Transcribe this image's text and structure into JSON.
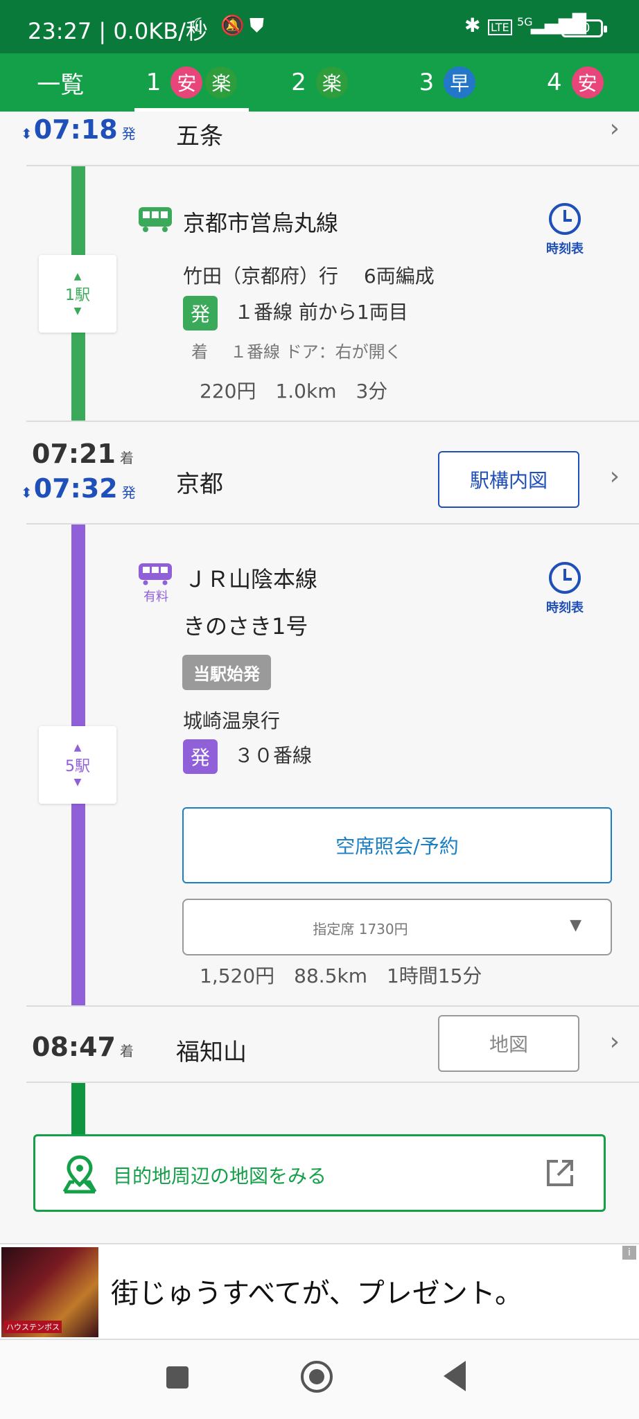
{
  "status_bar": {
    "time": "23:27",
    "speed": "0.0KB/秒",
    "battery": "80",
    "network": "5G"
  },
  "tabs": [
    {
      "num": "一覧",
      "badges": []
    },
    {
      "num": "1",
      "badges": [
        "安",
        "楽"
      ]
    },
    {
      "num": "2",
      "badges": [
        "楽"
      ]
    },
    {
      "num": "3",
      "badges": [
        "早"
      ]
    },
    {
      "num": "4",
      "badges": [
        "安"
      ]
    }
  ],
  "stations": {
    "gojo": {
      "dep_time": "07:18",
      "dep_suffix": "発",
      "name": "五条"
    },
    "kyoto": {
      "arr_time": "07:21",
      "arr_suffix": "着",
      "dep_time": "07:32",
      "dep_suffix": "発",
      "name": "京都",
      "button": "駅構内図"
    },
    "fukuchiyama": {
      "arr_time": "08:47",
      "arr_suffix": "着",
      "name": "福知山",
      "button": "地図"
    }
  },
  "segment1": {
    "line": "京都市営烏丸線",
    "dest": "竹田（京都府）行　 6両編成",
    "dep_label": "発",
    "dep_info": "１番線 前から1両目",
    "arr_label": "着",
    "arr_info": "１番線 ドア：右が開く",
    "summary": "220円　1.0km　3分",
    "stops": "1駅",
    "timetable": "時刻表",
    "color": "#3aaa5a"
  },
  "segment2": {
    "line": "ＪＲ山陰本線",
    "paid": "有料",
    "train": "きのさき1号",
    "origin_badge": "当駅始発",
    "dest": "城崎温泉行",
    "dep_label": "発",
    "dep_info": "３０番線",
    "reserve": "空席照会/予約",
    "seat_select": "指定席 1730円",
    "summary": "1,520円　88.5km　1時間15分",
    "stops": "5駅",
    "timetable": "時刻表",
    "color": "#9060d8"
  },
  "destination_map": {
    "label": "目的地周辺の地図をみる"
  },
  "ad": {
    "text": "街じゅうすべてが、プレゼント。",
    "image_caption": "ハウステンボス"
  },
  "colors": {
    "accent_green": "#14a048",
    "dark_green": "#0a7a3a",
    "blue": "#1f4fb8"
  }
}
